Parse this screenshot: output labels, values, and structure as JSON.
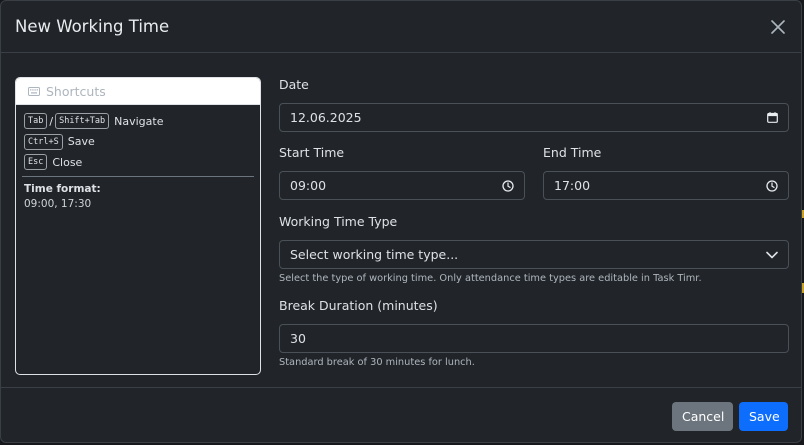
{
  "modal": {
    "title": "New Working Time"
  },
  "shortcuts": {
    "header": "Shortcuts",
    "items": [
      {
        "keys": [
          "Tab",
          "Shift+Tab"
        ],
        "separator": "/",
        "label": "Navigate"
      },
      {
        "keys": [
          "Ctrl+S"
        ],
        "label": "Save"
      },
      {
        "keys": [
          "Esc"
        ],
        "label": "Close"
      }
    ],
    "time_format_label": "Time format:",
    "time_format_value": "09:00, 17:30"
  },
  "form": {
    "date": {
      "label": "Date",
      "value": "12.06.2025"
    },
    "start_time": {
      "label": "Start Time",
      "value": "09:00"
    },
    "end_time": {
      "label": "End Time",
      "value": "17:00"
    },
    "working_time_type": {
      "label": "Working Time Type",
      "placeholder": "Select working time type...",
      "help": "Select the type of working time. Only attendance time types are editable in Task Timr."
    },
    "break_duration": {
      "label": "Break Duration (minutes)",
      "value": "30",
      "help": "Standard break of 30 minutes for lunch."
    }
  },
  "footer": {
    "cancel_label": "Cancel",
    "save_label": "Save"
  },
  "colors": {
    "primary": "#0d6efd",
    "secondary": "#6c757d",
    "modal_bg": "#212529"
  },
  "icons": {
    "close": "close-icon",
    "calendar": "calendar-icon",
    "clock": "clock-icon",
    "chevron": "chevron-down-icon",
    "keyboard": "keyboard-icon"
  }
}
